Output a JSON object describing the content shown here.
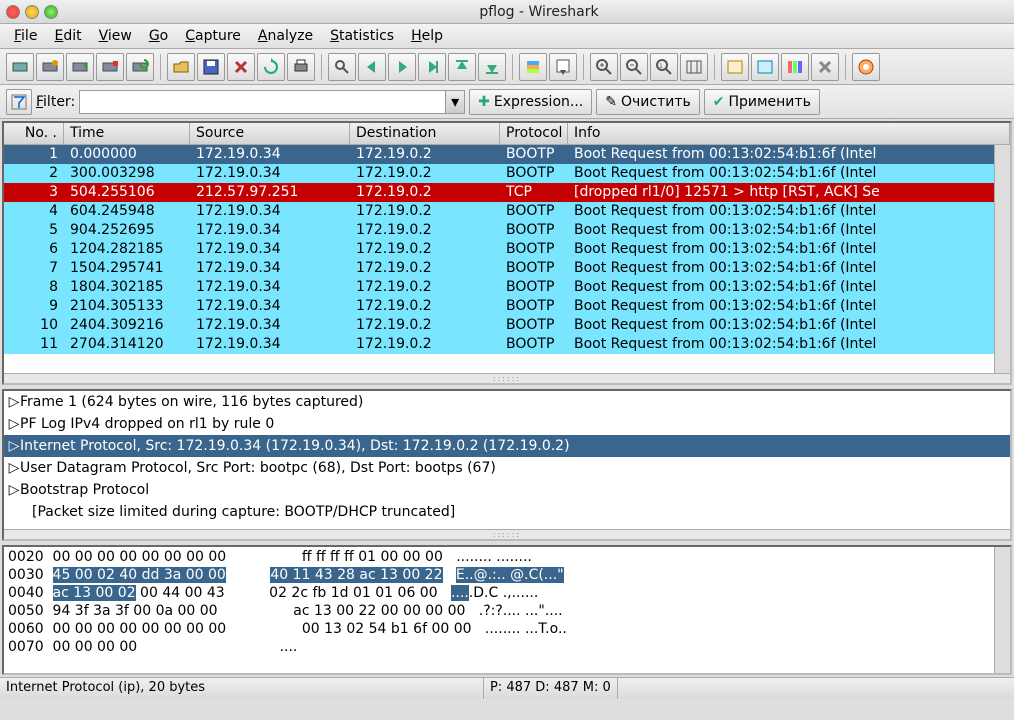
{
  "window": {
    "title": "pflog - Wireshark"
  },
  "menu": [
    "File",
    "Edit",
    "View",
    "Go",
    "Capture",
    "Analyze",
    "Statistics",
    "Help"
  ],
  "filter": {
    "label": "Filter:",
    "value": "",
    "btn_expression": "Expression...",
    "btn_clear": "Очистить",
    "btn_apply": "Применить"
  },
  "columns": {
    "no": "No. .",
    "time": "Time",
    "src": "Source",
    "dst": "Destination",
    "proto": "Protocol",
    "info": "Info"
  },
  "packets": [
    {
      "no": 1,
      "time": "0.000000",
      "src": "172.19.0.34",
      "dst": "172.19.0.2",
      "proto": "BOOTP",
      "info": "Boot Request from 00:13:02:54:b1:6f (Intel",
      "cls": "row-bootp row-sel"
    },
    {
      "no": 2,
      "time": "300.003298",
      "src": "172.19.0.34",
      "dst": "172.19.0.2",
      "proto": "BOOTP",
      "info": "Boot Request from 00:13:02:54:b1:6f (Intel",
      "cls": "row-bootp"
    },
    {
      "no": 3,
      "time": "504.255106",
      "src": "212.57.97.251",
      "dst": "172.19.0.2",
      "proto": "TCP",
      "info": "[dropped rl1/0] 12571 > http [RST, ACK] Se",
      "cls": "row-tcp-drop"
    },
    {
      "no": 4,
      "time": "604.245948",
      "src": "172.19.0.34",
      "dst": "172.19.0.2",
      "proto": "BOOTP",
      "info": "Boot Request from 00:13:02:54:b1:6f (Intel",
      "cls": "row-bootp"
    },
    {
      "no": 5,
      "time": "904.252695",
      "src": "172.19.0.34",
      "dst": "172.19.0.2",
      "proto": "BOOTP",
      "info": "Boot Request from 00:13:02:54:b1:6f (Intel",
      "cls": "row-bootp"
    },
    {
      "no": 6,
      "time": "1204.282185",
      "src": "172.19.0.34",
      "dst": "172.19.0.2",
      "proto": "BOOTP",
      "info": "Boot Request from 00:13:02:54:b1:6f (Intel",
      "cls": "row-bootp"
    },
    {
      "no": 7,
      "time": "1504.295741",
      "src": "172.19.0.34",
      "dst": "172.19.0.2",
      "proto": "BOOTP",
      "info": "Boot Request from 00:13:02:54:b1:6f (Intel",
      "cls": "row-bootp"
    },
    {
      "no": 8,
      "time": "1804.302185",
      "src": "172.19.0.34",
      "dst": "172.19.0.2",
      "proto": "BOOTP",
      "info": "Boot Request from 00:13:02:54:b1:6f (Intel",
      "cls": "row-bootp"
    },
    {
      "no": 9,
      "time": "2104.305133",
      "src": "172.19.0.34",
      "dst": "172.19.0.2",
      "proto": "BOOTP",
      "info": "Boot Request from 00:13:02:54:b1:6f (Intel",
      "cls": "row-bootp"
    },
    {
      "no": 10,
      "time": "2404.309216",
      "src": "172.19.0.34",
      "dst": "172.19.0.2",
      "proto": "BOOTP",
      "info": "Boot Request from 00:13:02:54:b1:6f (Intel",
      "cls": "row-bootp"
    },
    {
      "no": 11,
      "time": "2704.314120",
      "src": "172.19.0.34",
      "dst": "172.19.0.2",
      "proto": "BOOTP",
      "info": "Boot Request from 00:13:02:54:b1:6f (Intel",
      "cls": "row-bootp"
    }
  ],
  "tree": [
    {
      "text": "Frame 1 (624 bytes on wire, 116 bytes captured)",
      "exp": "▷",
      "sel": false
    },
    {
      "text": "PF Log IPv4 dropped on rl1 by rule 0",
      "exp": "▷",
      "sel": false
    },
    {
      "text": "Internet Protocol, Src: 172.19.0.34 (172.19.0.34), Dst: 172.19.0.2 (172.19.0.2)",
      "exp": "▷",
      "sel": true
    },
    {
      "text": "User Datagram Protocol, Src Port: bootpc (68), Dst Port: bootps (67)",
      "exp": "▷",
      "sel": false
    },
    {
      "text": "Bootstrap Protocol",
      "exp": "▷",
      "sel": false
    },
    {
      "text": "[Packet size limited during capture: BOOTP/DHCP truncated]",
      "exp": "",
      "sel": false,
      "indent": true
    }
  ],
  "hex": [
    {
      "off": "0020",
      "h1": "00 00 00 00 00 00 00 00",
      "h2": "ff ff ff ff 01 00 00 00",
      "asc": "........ ........"
    },
    {
      "off": "0030",
      "h1": "45 00 02 40 dd 3a 00 00",
      "h2": "40 11 43 28 ac 13 00 22",
      "asc": "E..@.:.. @.C(...\"",
      "sel1": true,
      "sel2": true,
      "selasc": true
    },
    {
      "off": "0040",
      "h1": "ac 13 00 02",
      "h1b": " 00 44 00 43",
      "h2": "02 2c fb 1d 01 01 06 00",
      "asc_a": "....",
      ".asc_b": ".D.C .,......",
      "sel1a": true
    },
    {
      "off": "0050",
      "h1": "94 3f 3a 3f 00 0a 00 00",
      "h2": "ac 13 00 22 00 00 00 00",
      "asc": ".?:?.... ...\"...."
    },
    {
      "off": "0060",
      "h1": "00 00 00 00 00 00 00 00",
      "h2": "00 13 02 54 b1 6f 00 00",
      "asc": "........ ...T.o.."
    },
    {
      "off": "0070",
      "h1": "00 00 00 00",
      "h2": "",
      "asc": "...."
    }
  ],
  "status": {
    "left": "Internet Protocol (ip), 20 bytes",
    "right": "P: 487 D: 487 M: 0"
  },
  "icons": {
    "names": [
      "interfaces",
      "options",
      "start",
      "stop",
      "restart",
      "open",
      "save",
      "close",
      "reload",
      "print",
      "find",
      "prev",
      "next",
      "jump",
      "first",
      "last",
      "colorize",
      "autoscroll",
      "zoom-in",
      "zoom-out",
      "zoom-100",
      "resize-cols",
      "cap-filters",
      "disp-filters",
      "coloring-rules",
      "prefs",
      "help"
    ]
  }
}
